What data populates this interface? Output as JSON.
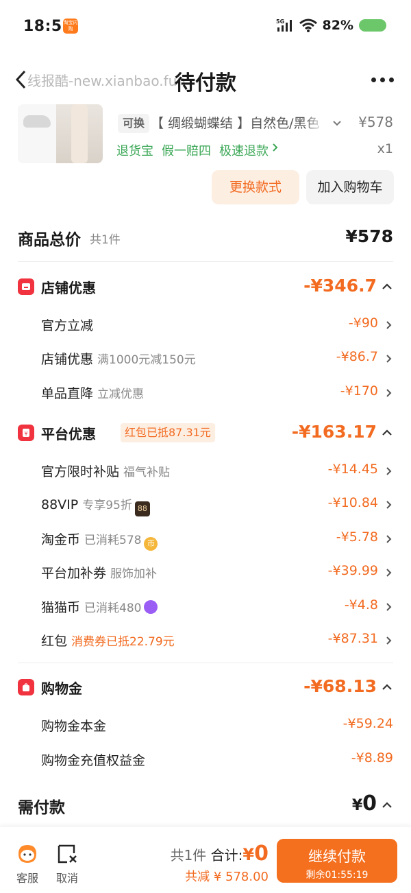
{
  "status_bar": {
    "time": "18:56",
    "app_badge": "淘宝闪购",
    "network": "5G",
    "battery": "82%"
  },
  "nav": {
    "title": "待付款",
    "watermark": "线报酷-new.xianbao.fun"
  },
  "product": {
    "exchange_tag": "可换",
    "variant": "【 绸缎蝴蝶结 】自然色/黑色",
    "price": "¥578",
    "service_tags": [
      "退货宝",
      "假一赔四",
      "极速退款"
    ],
    "qty": "x1",
    "change_button": "更换款式",
    "cart_button": "加入购物车"
  },
  "total": {
    "label": "商品总价",
    "count": "共1件",
    "price": "¥578"
  },
  "shop_discount": {
    "title": "店铺优惠",
    "amount": "-¥346.7",
    "items": [
      {
        "label": "官方立减",
        "sub": "",
        "amount": "-¥90"
      },
      {
        "label": "店铺优惠",
        "sub": "满1000元减150元",
        "amount": "-¥86.7"
      },
      {
        "label": "单品直降",
        "sub": "立减优惠",
        "amount": "-¥170"
      }
    ]
  },
  "platform_discount": {
    "title": "平台优惠",
    "tag": "红包已抵87.31元",
    "amount": "-¥163.17",
    "items": [
      {
        "label": "官方限时补贴",
        "sub": "福气补贴",
        "amount": "-¥14.45"
      },
      {
        "label": "88VIP",
        "sub": "专享95折",
        "badge": "88",
        "amount": "-¥10.84"
      },
      {
        "label": "淘金币",
        "sub": "已消耗578",
        "badge": "币",
        "amount": "-¥5.78"
      },
      {
        "label": "平台加补券",
        "sub": "服饰加补",
        "amount": "-¥39.99"
      },
      {
        "label": "猫猫币",
        "sub": "已消耗480",
        "amount": "-¥4.8"
      },
      {
        "label": "红包",
        "sub": "消费券已抵22.79元",
        "amount": "-¥87.31"
      }
    ]
  },
  "shopping_credit": {
    "title": "购物金",
    "amount": "-¥68.13",
    "items": [
      {
        "label": "购物金本金",
        "amount": "-¥59.24"
      },
      {
        "label": "购物金充值权益金",
        "amount": "-¥8.89"
      }
    ]
  },
  "payable": {
    "label": "需付款",
    "currency": "¥",
    "amount": "0"
  },
  "bottom_bar": {
    "service_label": "客服",
    "cancel_label": "取消",
    "count": "共1件",
    "total_label": "合计:",
    "total_currency": "¥",
    "total_value": "0",
    "saved": "共减 ¥ 578.00",
    "pay_button": "继续付款",
    "timer": "剩余01:55:19"
  },
  "colors": {
    "accent": "#f26b21",
    "green": "#3aa755",
    "red_icon": "#f0333f",
    "pay_button": "#f4701f"
  }
}
